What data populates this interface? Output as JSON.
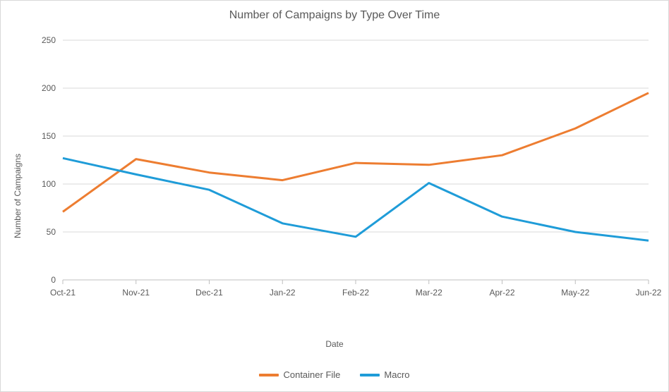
{
  "chart_data": {
    "type": "line",
    "title": "Number of Campaigns by Type Over Time",
    "xlabel": "Date",
    "ylabel": "Number of Campaigns",
    "categories": [
      "Oct-21",
      "Nov-21",
      "Dec-21",
      "Jan-22",
      "Feb-22",
      "Mar-22",
      "Apr-22",
      "May-22",
      "Jun-22"
    ],
    "series": [
      {
        "name": "Container File",
        "color": "#ED7D31",
        "values": [
          71,
          126,
          112,
          104,
          122,
          120,
          130,
          158,
          195
        ]
      },
      {
        "name": "Macro",
        "color": "#1F9CD8",
        "values": [
          127,
          110,
          94,
          59,
          45,
          101,
          66,
          50,
          41
        ]
      }
    ],
    "ylim": [
      0,
      250
    ],
    "yticks": [
      0,
      50,
      100,
      150,
      200,
      250
    ],
    "grid": true,
    "legend_position": "bottom"
  }
}
